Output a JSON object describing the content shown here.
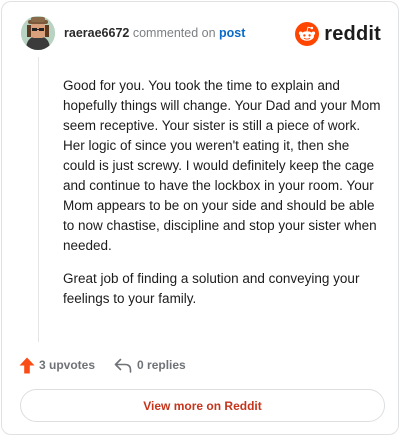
{
  "header": {
    "username": "raerae6672",
    "action_text": "commented on",
    "post_link": "post",
    "brand_name": "reddit"
  },
  "comment": {
    "paragraphs": [
      "Good for you. You took the time to explain and hopefully things will change. Your Dad and your Mom seem receptive. Your sister is still a piece of work. Her logic of since you weren't eating it, then she could is just screwy. I would definitely keep the cage and continue to have the lockbox in your room. Your Mom appears to be on your side and should be able to now chastise, discipline and stop your sister when needed.",
      "Great job of finding a solution and conveying your feelings to your family."
    ]
  },
  "actions": {
    "upvotes": "3 upvotes",
    "replies": "0 replies"
  },
  "footer": {
    "view_more_label": "View more on Reddit"
  },
  "colors": {
    "brand_orange": "#ff4500",
    "upvote_orange": "#fa4c16",
    "link_blue": "#0a6ac8",
    "view_more_red": "#c5341b"
  },
  "icons": [
    "avatar",
    "reddit-logo-icon",
    "upvote-arrow-icon",
    "reply-arrow-icon"
  ]
}
